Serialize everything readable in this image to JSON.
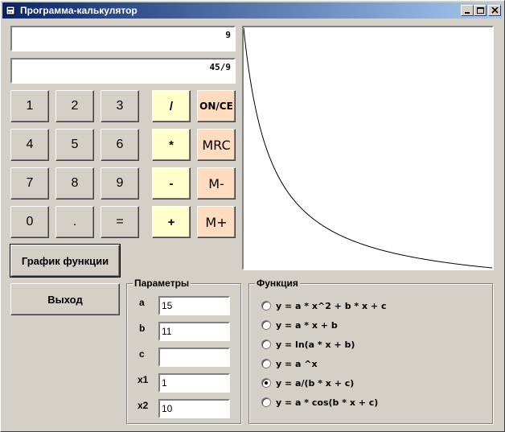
{
  "window": {
    "title": "Программа-калькулятор"
  },
  "display": {
    "primary": "9",
    "secondary": "45/9"
  },
  "keypad": {
    "digits": [
      "1",
      "2",
      "3",
      "4",
      "5",
      "6",
      "7",
      "8",
      "9",
      "0",
      ".",
      "="
    ],
    "ops": [
      "/",
      "*",
      "-",
      "+"
    ],
    "memory": [
      "ON/CE",
      "MRC",
      "M-",
      "M+"
    ]
  },
  "buttons": {
    "graph": "График функции",
    "exit": "Выход"
  },
  "params": {
    "legend": "Параметры",
    "fields": [
      {
        "label": "a",
        "value": "15"
      },
      {
        "label": "b",
        "value": "11"
      },
      {
        "label": "c",
        "value": ""
      },
      {
        "label": "x1",
        "value": "1"
      },
      {
        "label": "x2",
        "value": "10"
      }
    ]
  },
  "functions": {
    "legend": "Функция",
    "options": [
      {
        "label": "y = a * x^2 + b * x + c",
        "checked": false
      },
      {
        "label": "y = a * x + b",
        "checked": false
      },
      {
        "label": "y = ln(a * x + b)",
        "checked": false
      },
      {
        "label": "y = a ^x",
        "checked": false
      },
      {
        "label": "y = a/(b * x + c)",
        "checked": true
      },
      {
        "label": "y = a * cos(b * x + c)",
        "checked": false
      }
    ]
  },
  "graph": {
    "type": "line",
    "function": "a/(b*x+c)",
    "a": 15,
    "b": 11,
    "c": 0,
    "x_range": [
      1,
      10
    ]
  }
}
